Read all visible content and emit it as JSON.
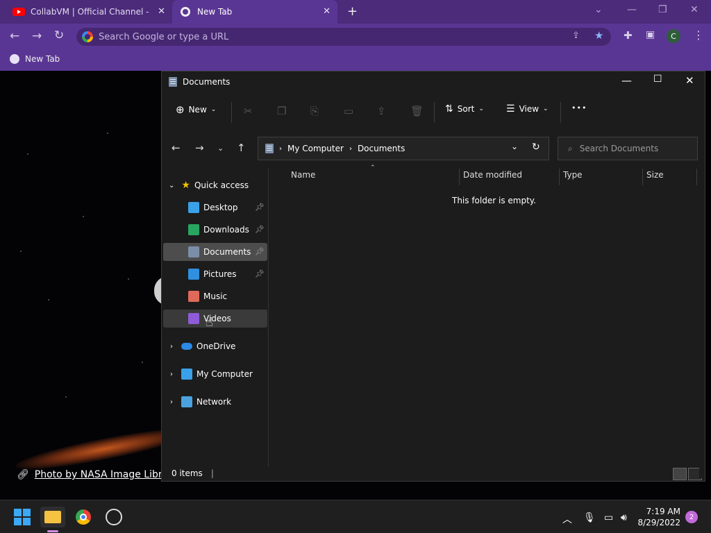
{
  "browser": {
    "tabs": [
      {
        "label": "CollabVM | Official Channel - You",
        "close": "✕"
      },
      {
        "label": "New Tab",
        "close": "✕"
      }
    ],
    "new_tab": "+",
    "omnibox_placeholder": "Search Google or type a URL",
    "profile_initial": "C",
    "bookmark": "New Tab"
  },
  "background": {
    "credit": "Photo by NASA Image Library"
  },
  "explorer": {
    "title": "Documents",
    "commands": {
      "new": "New",
      "sort": "Sort",
      "view": "View",
      "more": "•••"
    },
    "address": {
      "crumbs": [
        "My Computer",
        "Documents"
      ]
    },
    "search_placeholder": "Search Documents",
    "nav": {
      "quick_access": "Quick access",
      "items": [
        {
          "label": "Desktop",
          "color": "#3aa0e8",
          "pinned": true
        },
        {
          "label": "Downloads",
          "color": "#27a65f",
          "pinned": true
        },
        {
          "label": "Documents",
          "color": "#7b8ea8",
          "pinned": true,
          "selected": true
        },
        {
          "label": "Pictures",
          "color": "#2f8fe0",
          "pinned": true
        },
        {
          "label": "Music",
          "color": "#e06a5a",
          "pinned": false
        },
        {
          "label": "Videos",
          "color": "#8f5bd8",
          "pinned": false,
          "hover": true
        }
      ],
      "roots": [
        "OneDrive",
        "My Computer",
        "Network"
      ]
    },
    "columns": [
      "Name",
      "Date modified",
      "Type",
      "Size"
    ],
    "empty_message": "This folder is empty.",
    "status": "0 items"
  },
  "taskbar": {
    "clock_time": "7:19 AM",
    "clock_date": "8/29/2022",
    "notifications": "2"
  }
}
